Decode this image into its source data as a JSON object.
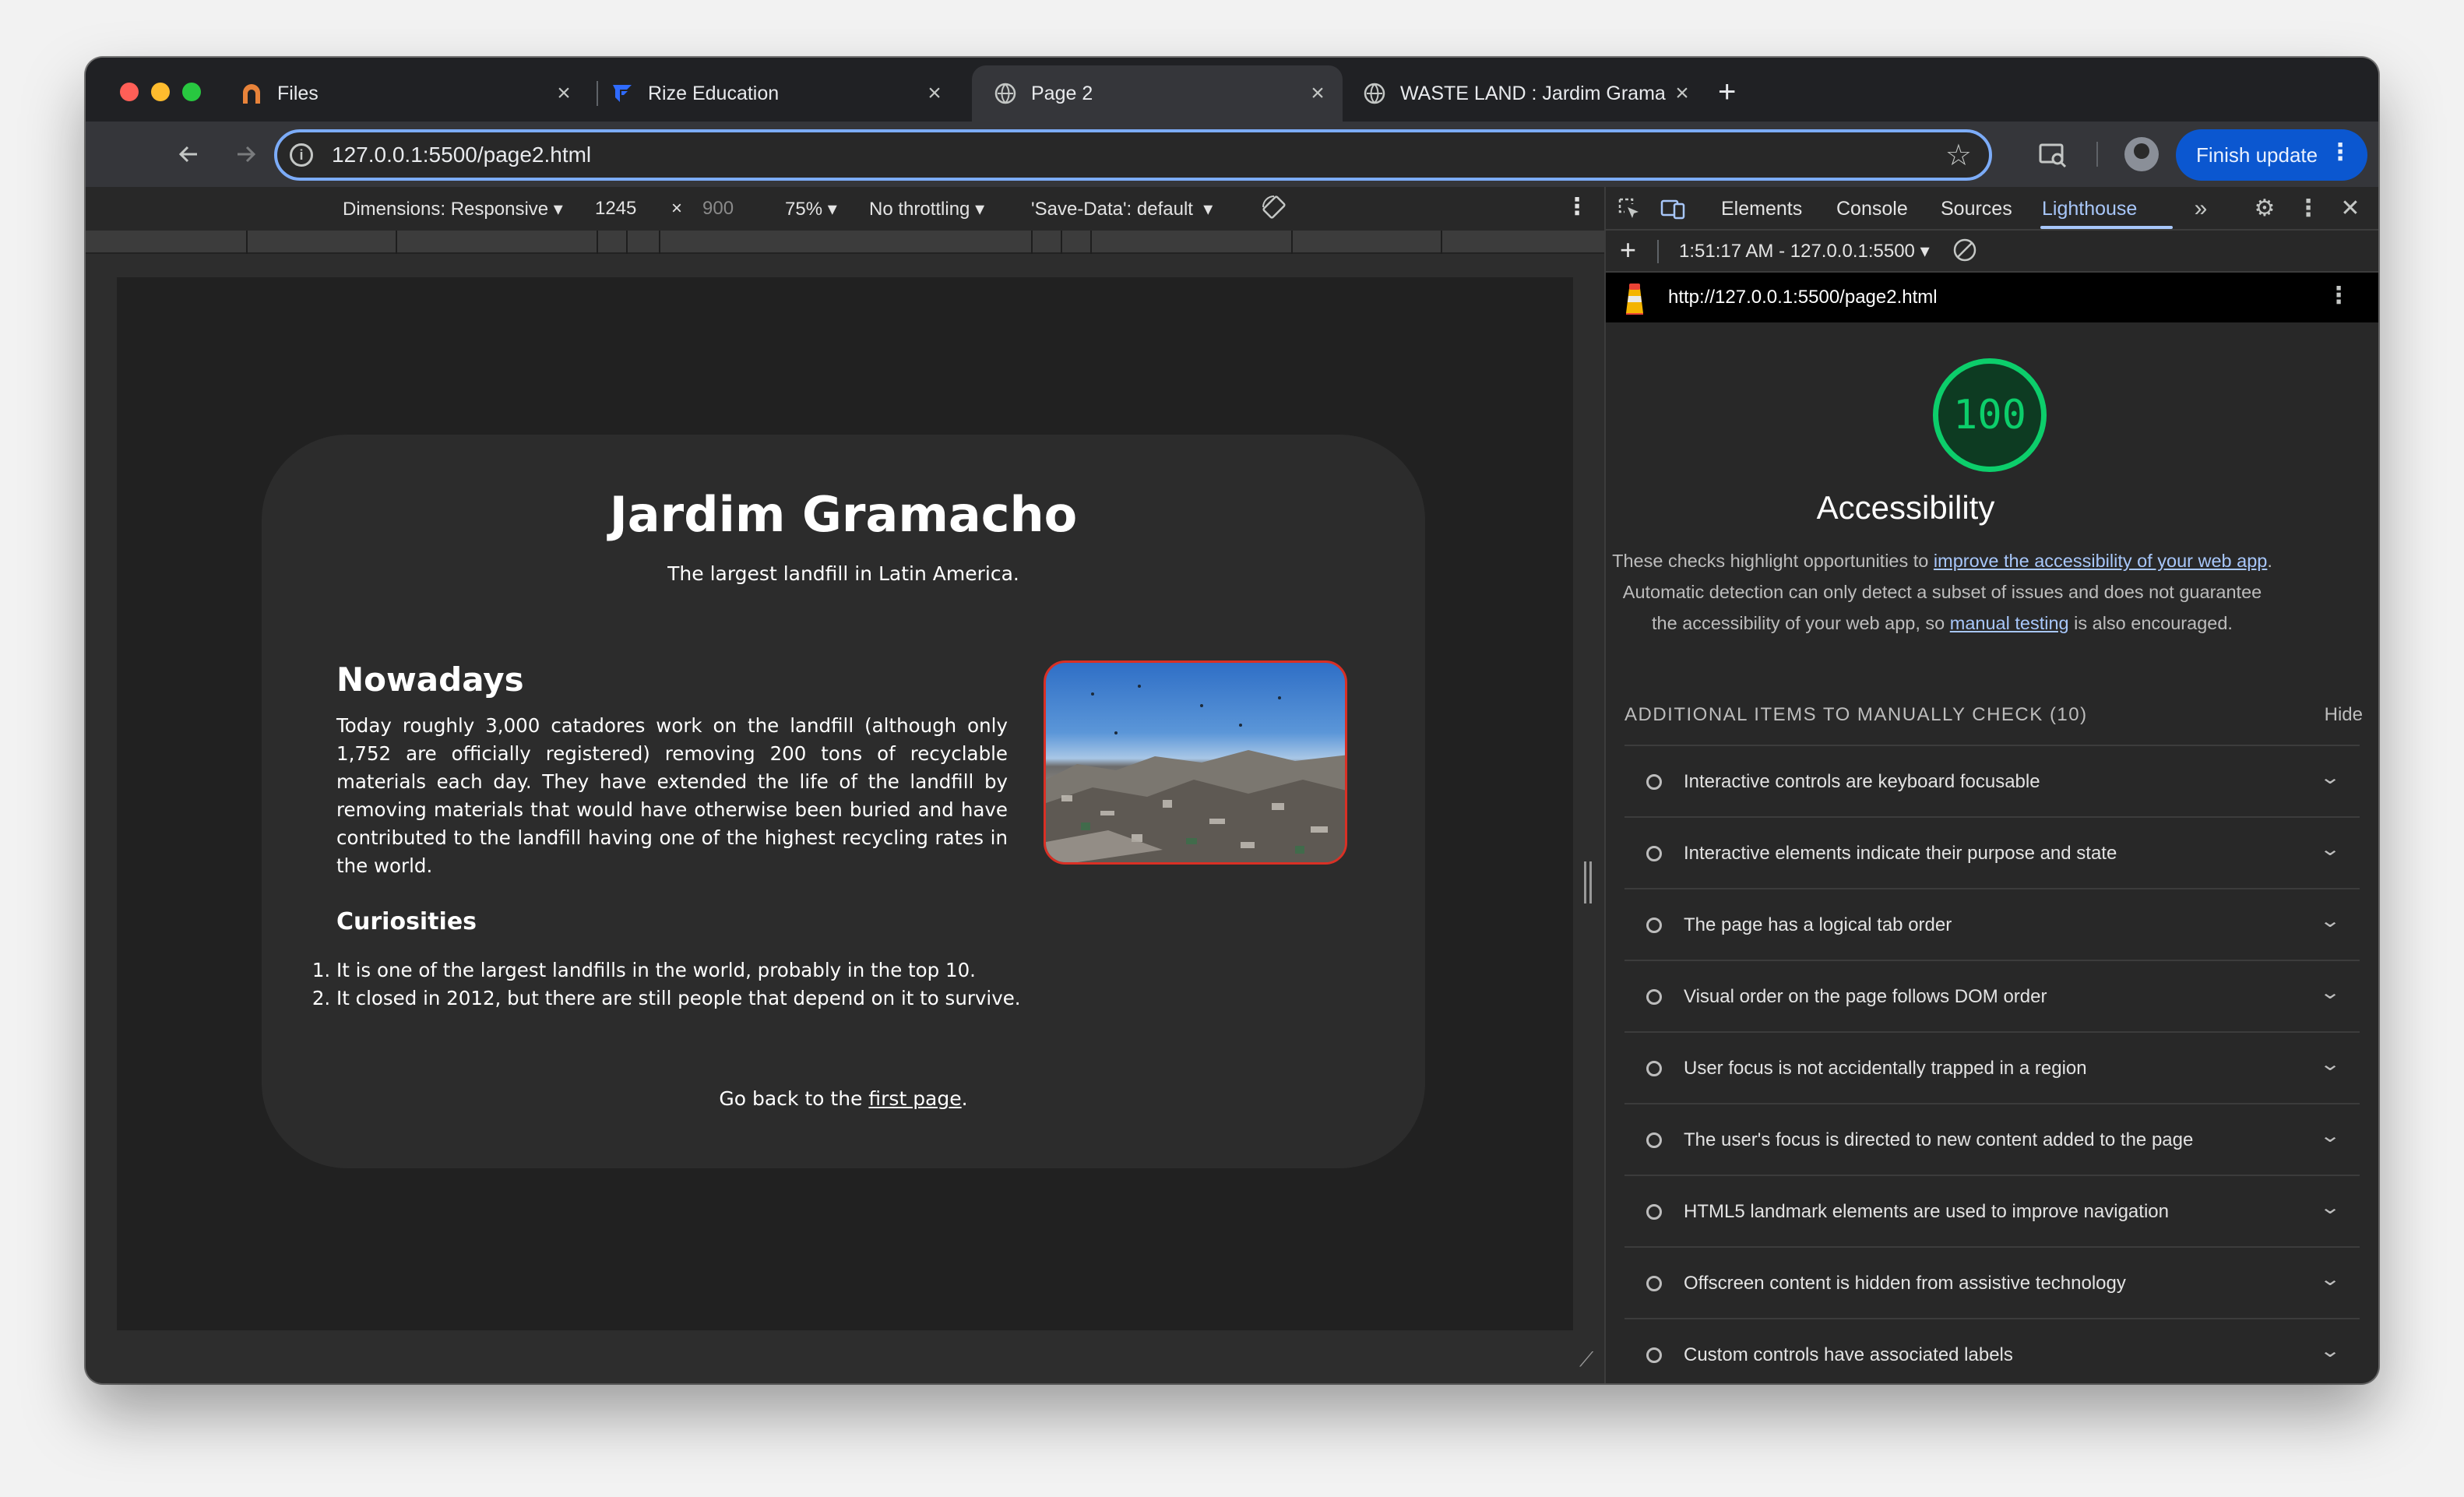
{
  "browser": {
    "tabs": [
      {
        "title": "Files",
        "active": false
      },
      {
        "title": "Rize Education",
        "active": false
      },
      {
        "title": "Page 2",
        "active": true
      },
      {
        "title": "WASTE LAND : Jardim Grama",
        "active": false
      }
    ],
    "close_glyph": "×",
    "new_tab_glyph": "+",
    "url": "127.0.0.1:5500/page2.html",
    "finish_update_label": "Finish update"
  },
  "device_toolbar": {
    "dimensions_label": "Dimensions: Responsive",
    "width": "1245",
    "times": "×",
    "height": "900",
    "zoom": "75%",
    "throttling": "No throttling",
    "save_data": "'Save-Data': default"
  },
  "page": {
    "title": "Jardim Gramacho",
    "subtitle": "The largest landfill in Latin America.",
    "section_heading": "Nowadays",
    "body": "Today roughly 3,000 catadores work on the landfill (although only 1,752 are officially registered) removing 200 tons of recyclable materials each day. They have extended the life of the landfill by removing materials that would have otherwise been buried and have contributed to the landfill having one of the highest recycling rates in the world.",
    "curiosities_heading": "Curiosities",
    "curiosities": [
      "It is one of the largest landfills in the world, probably in the top 10.",
      "It closed in 2012, but there are still people that depend on it to survive."
    ],
    "back_prefix": "Go back to the ",
    "back_link": "first page",
    "back_suffix": "."
  },
  "devtools": {
    "tabs": [
      "Elements",
      "Console",
      "Sources",
      "Lighthouse"
    ],
    "active_tab": "Lighthouse",
    "report_time": "1:51:17 AM - 127.0.0.1:5500",
    "report_url": "http://127.0.0.1:5500/page2.html",
    "score": "100",
    "category": "Accessibility",
    "desc_1": "These checks highlight opportunities to ",
    "desc_link_1": "improve the accessibility of your web app",
    "desc_2": ". Automatic detection can only detect a subset of issues and does not guarantee the accessibility of your web app, so ",
    "desc_link_2": "manual testing",
    "desc_3": " is also encouraged.",
    "manual_heading": "ADDITIONAL ITEMS TO MANUALLY CHECK (10)",
    "hide_label": "Hide",
    "audits": [
      "Interactive controls are keyboard focusable",
      "Interactive elements indicate their purpose and state",
      "The page has a logical tab order",
      "Visual order on the page follows DOM order",
      "User focus is not accidentally trapped in a region",
      "The user's focus is directed to new content added to the page",
      "HTML5 landmark elements are used to improve navigation",
      "Offscreen content is hidden from assistive technology",
      "Custom controls have associated labels"
    ]
  },
  "colors": {
    "score_green": "#0cce6b",
    "accent_blue": "#a8c7fa",
    "image_border": "#d93025",
    "update_button": "#0b57d0"
  }
}
